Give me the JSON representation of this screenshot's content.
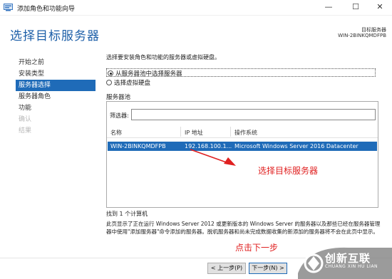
{
  "window": {
    "title": "添加角色和功能向导",
    "minimize": "—",
    "maximize": "☐",
    "close": "✕"
  },
  "header": {
    "title": "选择目标服务器",
    "dest_label": "目标服务器",
    "dest_server": "WIN-2BINKQMDFPB"
  },
  "nav": {
    "items": [
      {
        "label": "开始之前",
        "state": "normal"
      },
      {
        "label": "安装类型",
        "state": "normal"
      },
      {
        "label": "服务器选择",
        "state": "active"
      },
      {
        "label": "服务器角色",
        "state": "normal"
      },
      {
        "label": "功能",
        "state": "normal"
      },
      {
        "label": "确认",
        "state": "disabled"
      },
      {
        "label": "结果",
        "state": "disabled"
      }
    ]
  },
  "main": {
    "instruction": "选择要安装角色和功能的服务器或虚拟硬盘。",
    "options": [
      {
        "label": "从服务器池中选择服务器",
        "checked": true
      },
      {
        "label": "选择虚拟硬盘",
        "checked": false
      }
    ],
    "pool_label": "服务器池",
    "filter_label": "筛选器:",
    "filter_value": "",
    "columns": [
      "名称",
      "IP 地址",
      "操作系统"
    ],
    "rows": [
      {
        "name": "WIN-2BINKQMDFPB",
        "ip": "192.168.100.1...",
        "os": "Microsoft Windows Server 2016 Datacenter"
      }
    ],
    "found": "找到 1 个计算机",
    "description": "此页显示了正在运行 Windows Server 2012 或更新版本的 Windows Server 的服务器以及那些已经在服务器管理器中使用\"添加服务器\"命令添加的服务器。脱机服务器和尚未完成数据收集的新添加的服务器将不会在此页中显示。"
  },
  "annotations": {
    "select_target": "选择目标服务器",
    "click_next": "点击下一步"
  },
  "footer": {
    "prev_label": "< 上一步(P)",
    "next_label": "下一步(N) >"
  },
  "watermark": {
    "name": "创新互联",
    "sub": "CHUANG XIN HU LIAN"
  },
  "colors": {
    "accent": "#1f6bb8",
    "title_blue": "#1d5fa8",
    "annotation_red": "#e02020"
  }
}
